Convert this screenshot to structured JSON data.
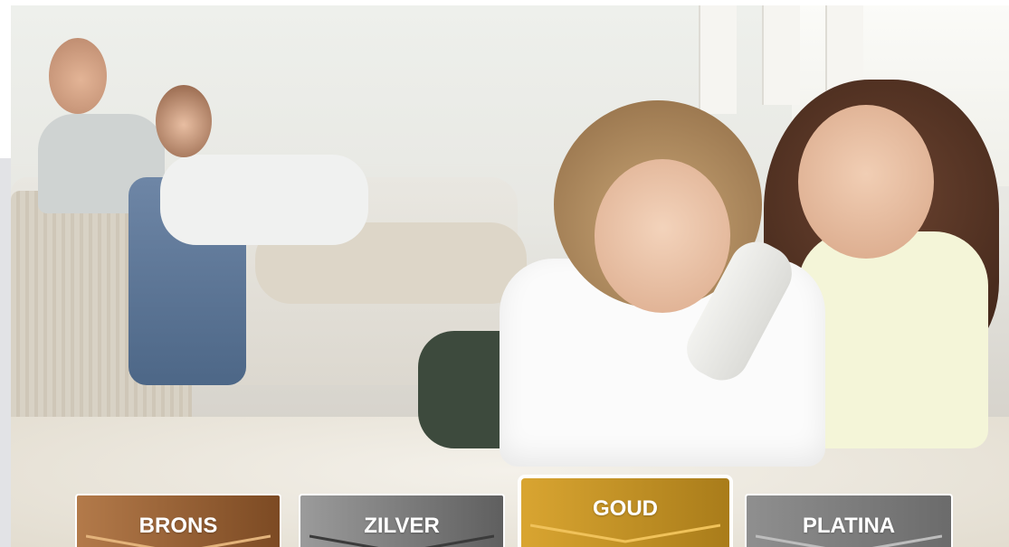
{
  "packages": [
    {
      "id": "brons",
      "label": "BRONS",
      "color_start": "#b37a4a",
      "color_end": "#7c4a23",
      "chevron": "#e3b37b",
      "active": false
    },
    {
      "id": "zilver",
      "label": "ZILVER",
      "color_start": "#9b9b9b",
      "color_end": "#5f5f5f",
      "chevron": "#3b3b3b",
      "active": false
    },
    {
      "id": "goud",
      "label": "GOUD",
      "color_start": "#d9a531",
      "color_end": "#a97c1a",
      "chevron": "#f0c25a",
      "active": true
    },
    {
      "id": "platina",
      "label": "PLATINA",
      "color_start": "#8f8f8f",
      "color_end": "#6b6b6b",
      "chevron": "#bdbdbd",
      "active": false
    }
  ]
}
